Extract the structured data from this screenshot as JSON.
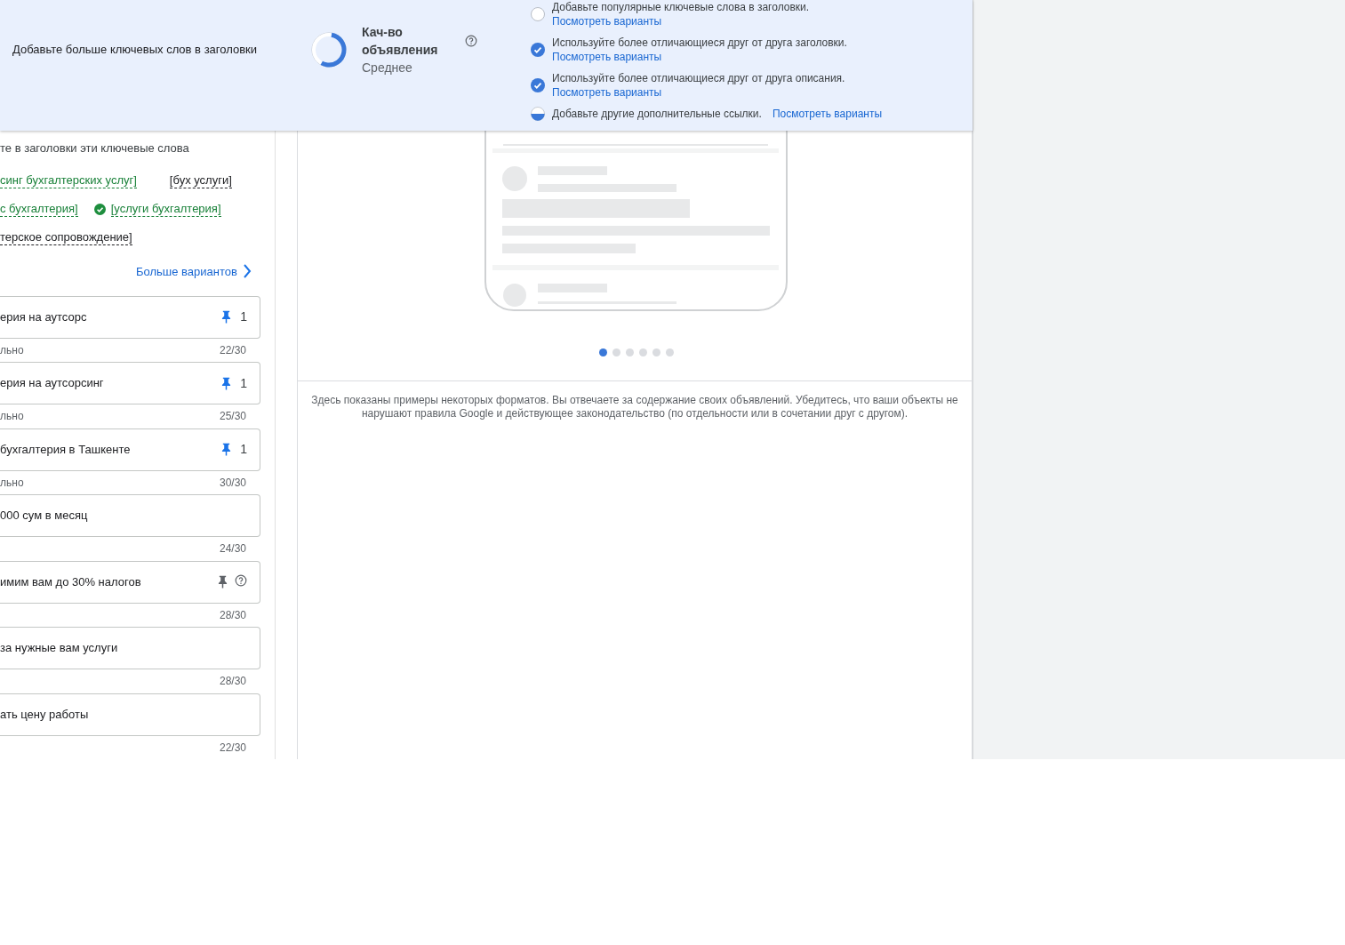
{
  "banner": {
    "tip": "Добавьте больше ключевых слов в заголовки",
    "quality": {
      "title": "Кач-во объявления",
      "rating": "Среднее",
      "level": 0.55
    },
    "checklist": [
      {
        "kind": "empty",
        "text": "Добавьте популярные ключевые слова в заголовки.",
        "link": "Посмотреть варианты"
      },
      {
        "kind": "done",
        "text": "Используйте более отличающиеся друг от друга заголовки.",
        "link": "Посмотреть варианты"
      },
      {
        "kind": "done",
        "text": "Используйте более отличающиеся друг от друга описания.",
        "link": "Посмотреть варианты"
      },
      {
        "kind": "partial",
        "text": "Добавьте другие дополнительные ссылки.",
        "link": "Посмотреть варианты",
        "inline": true
      }
    ]
  },
  "keywords": {
    "intro": "те в заголовки эти ключевые слова",
    "rows": [
      [
        {
          "text": "синг бухгалтерских услуг]",
          "used": true,
          "check_icon": false
        },
        {
          "text": "[бух услуги]",
          "used": false,
          "check_icon": false
        }
      ],
      [
        {
          "text": "с бухгалтерия]",
          "used": true,
          "check_icon": false
        },
        {
          "text": "[услуги бухгалтерия]",
          "used": true,
          "check_icon": true
        }
      ],
      [
        {
          "text": "терское сопровождение]",
          "used": false,
          "check_icon": false
        }
      ]
    ],
    "more": "Больше вариантов"
  },
  "headlines": [
    {
      "value": "ерия на аутсорс",
      "kind": "pinned",
      "pin_label": "1",
      "helper": "льно",
      "counter": "22/30"
    },
    {
      "value": "ерия на аутсорсинг",
      "kind": "pinned",
      "pin_label": "1",
      "helper": "льно",
      "counter": "25/30"
    },
    {
      "value": "бухгалтерия в Ташкенте",
      "kind": "pinned",
      "pin_label": "1",
      "helper": "льно",
      "counter": "30/30"
    },
    {
      "value": "000 сум в месяц",
      "kind": "plain",
      "counter": "24/30"
    },
    {
      "value": "имим вам до 30% налогов",
      "kind": "unpinned",
      "help": true,
      "counter": "28/30"
    },
    {
      "value": "за нужные вам услуги",
      "kind": "plain",
      "counter": "28/30"
    },
    {
      "value": "ать цену работы",
      "kind": "plain",
      "counter": "22/30"
    }
  ],
  "preview": {
    "pages": [
      {
        "selected": true
      },
      {
        "selected": false
      },
      {
        "selected": false
      },
      {
        "selected": false
      },
      {
        "selected": false
      },
      {
        "selected": false
      }
    ],
    "disclaimer": "Здесь показаны примеры некоторых форматов. Вы отвечаете за содержание своих объявлений. Убедитесь, что ваши объекты не нарушают правила Google и действующее законодательство (по отдельности или в сочетании друг с другом)."
  }
}
